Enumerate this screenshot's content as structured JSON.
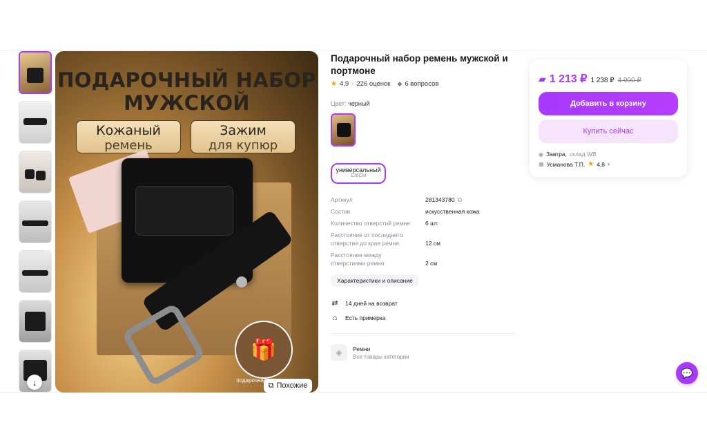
{
  "product": {
    "title": "Подарочный набор ремень мужской и портмоне",
    "rating": "4,9",
    "reviews": "226 оценок",
    "questions": "6 вопросов",
    "color_label": "Цвет:",
    "color_value": "черный",
    "size_label": "универсальный",
    "size_sub": "126СМ"
  },
  "image": {
    "headline_1": "ПОДАРОЧНЫЙ НАБОР",
    "headline_2": "МУЖСКОЙ",
    "badge_left_1": "Кожаный",
    "badge_left_2": "ремень",
    "badge_right_1": "Зажим",
    "badge_right_2": "для купюр",
    "gift_text": "подарочная упаковка",
    "similar_label": "Похожие"
  },
  "specs": [
    {
      "key": "Артикул",
      "value": "281343780"
    },
    {
      "key": "Состав",
      "value": "искусственная кожа"
    },
    {
      "key": "Количество отверстий ремня",
      "value": "6 шт."
    },
    {
      "key": "Расстояние от последнего отверстия до края ремня",
      "value": "12 см"
    },
    {
      "key": "Расстояние между отверстиями ремня",
      "value": "2 см"
    }
  ],
  "characteristics_button": "Характеристики и описание",
  "features": {
    "return": "14 дней на возврат",
    "fitting": "Есть примерка"
  },
  "category": {
    "name": "Ремни",
    "link": "Все товары категории"
  },
  "buy": {
    "price": "1 213 ₽",
    "price_regular": "1 238 ₽",
    "price_old": "4 900 ₽",
    "add_to_cart": "Добавить в корзину",
    "buy_now": "Купить сейчас",
    "delivery": "Завтра,",
    "warehouse": "склад WB",
    "seller": "Усманова Т.П.",
    "seller_rating": "4,8"
  },
  "colors": {
    "accent": "#a73afd",
    "accent_light": "#f6e4fd",
    "star": "#f2a100"
  }
}
